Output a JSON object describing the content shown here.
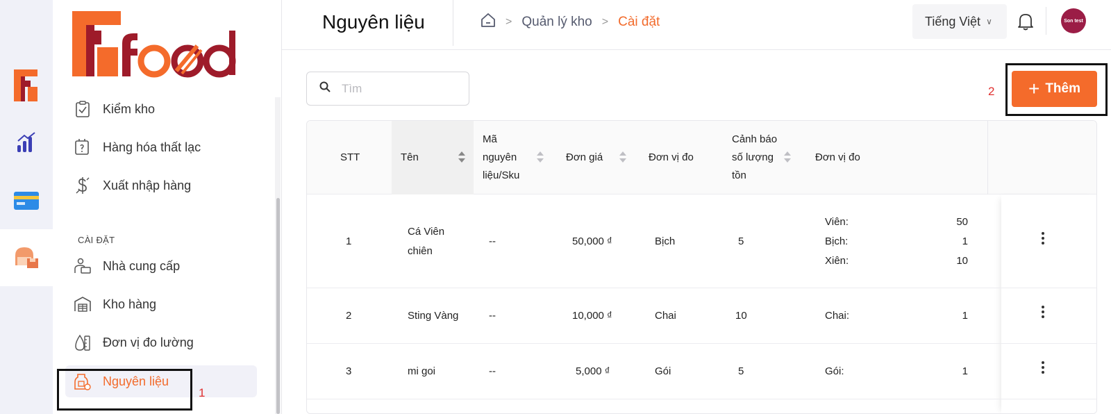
{
  "header": {
    "title": "Nguyên liệu",
    "breadcrumb": [
      "Quản lý kho",
      "Cài đặt"
    ],
    "language": "Tiếng Việt",
    "user_initials": "Son test"
  },
  "sidebar": {
    "logo_text": "Ffood",
    "items_top": [
      {
        "label": "Kiểm kho",
        "icon": "clipboard-check-icon"
      },
      {
        "label": "Hàng hóa thất lạc",
        "icon": "lost-goods-icon"
      },
      {
        "label": "Xuất nhập hàng",
        "icon": "dollar-icon"
      }
    ],
    "section_label": "CÀI ĐẶT",
    "items_settings": [
      {
        "label": "Nhà cung cấp",
        "icon": "supplier-icon"
      },
      {
        "label": "Kho hàng",
        "icon": "warehouse-icon"
      },
      {
        "label": "Đơn vị đo lường",
        "icon": "measure-unit-icon"
      },
      {
        "label": "Nguyên liệu",
        "icon": "ingredient-icon",
        "active": true
      }
    ]
  },
  "annotations": {
    "step1": "1",
    "step2": "2"
  },
  "search": {
    "placeholder": "Tìm",
    "value": ""
  },
  "toolbar": {
    "add_label": "Thêm"
  },
  "table": {
    "columns": [
      "STT",
      "Tên",
      "Mã nguyên liệu/Sku",
      "Đơn giá",
      "Đơn vị đo",
      "Cảnh báo số lượng tồn",
      "Đơn vị đo"
    ],
    "col_ma": [
      "Mã",
      "nguyên",
      "liệu/Sku"
    ],
    "col_canh_bao": [
      "Cảnh báo",
      "số lượng",
      "tồn"
    ],
    "rows": [
      {
        "stt": "1",
        "ten": [
          "Cá Viên",
          "chiên"
        ],
        "ma": "--",
        "don_gia": "50,000 ₫",
        "don_vi": "Bịch",
        "canh_bao": "5",
        "units": [
          {
            "name": "Viên:",
            "qty": "50"
          },
          {
            "name": "Bịch:",
            "qty": "1"
          },
          {
            "name": "Xiên:",
            "qty": "10"
          }
        ]
      },
      {
        "stt": "2",
        "ten": [
          "Sting Vàng"
        ],
        "ma": "--",
        "don_gia": "10,000 ₫",
        "don_vi": "Chai",
        "canh_bao": "10",
        "units": [
          {
            "name": "Chai:",
            "qty": "1"
          }
        ]
      },
      {
        "stt": "3",
        "ten": [
          "mi goi"
        ],
        "ma": "--",
        "don_gia": "5,000 ₫",
        "don_vi": "Gói",
        "canh_bao": "5",
        "units": [
          {
            "name": "Gói:",
            "qty": "1"
          }
        ]
      }
    ]
  },
  "colors": {
    "accent": "#f46b2b",
    "logo_red": "#9e1b2a",
    "avatar": "#9b1d46",
    "annotation": "#e0302f"
  }
}
